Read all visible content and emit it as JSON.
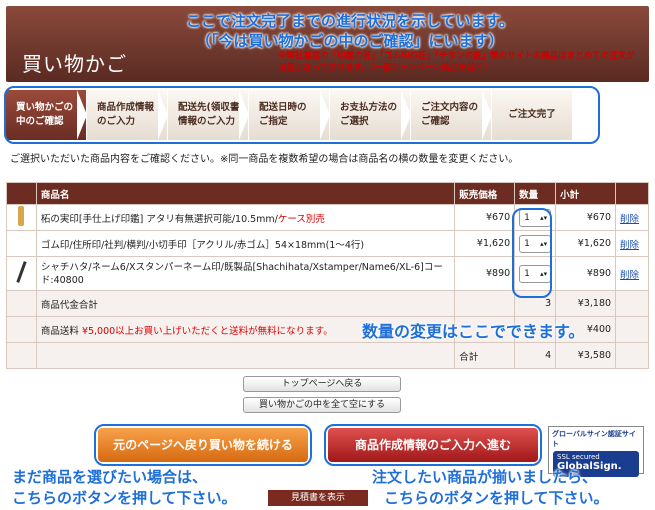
{
  "header": {
    "title": "買い物かご",
    "notice": "※弊社運営の「印鑑の匠」「ゴム印の匠」「チタンの匠」等のサイトの商品はまとめての注文が可能となっております。（一部キャンペーン商品を除く）"
  },
  "steps": [
    {
      "label": "買い物かごの\n中のご確認",
      "active": true
    },
    {
      "label": "商品作成情報\nのご入力",
      "active": false
    },
    {
      "label": "配送先(領収書)\n情報のご入力",
      "active": false
    },
    {
      "label": "配送日時の\nご指定",
      "active": false
    },
    {
      "label": "お支払方法の\nご選択",
      "active": false
    },
    {
      "label": "ご注文内容の\nご確認",
      "active": false
    },
    {
      "label": "ご注文完了",
      "active": false
    }
  ],
  "instruction": "ご選択いただいた商品内容をご確認ください。※同一商品を複数希望の場合は商品名の横の数量を変更ください。",
  "table": {
    "headers": {
      "name": "商品名",
      "price": "販売価格",
      "qty": "数量",
      "subtotal": "小計"
    },
    "items": [
      {
        "name": "柘の実印[手仕上げ印鑑] アタリ有無選択可能/10.5mm/",
        "name_red": "ケース別売",
        "price": "¥670",
        "qty": "1",
        "subtotal": "¥670",
        "delete": "削除"
      },
      {
        "name": "ゴム印/住所印/社判/横判/小切手印［アクリル/赤ゴム］54×18mm(1〜4行)",
        "name_red": "",
        "price": "¥1,620",
        "qty": "1",
        "subtotal": "¥1,620",
        "delete": "削除"
      },
      {
        "name": "シャチハタ/ネーム6/Xスタンパーネーム印/既製品[Shachihata/Xstamper/Name6/XL-6]コード:40800",
        "name_red": "",
        "price": "¥890",
        "qty": "1",
        "subtotal": "¥890",
        "delete": "削除"
      }
    ],
    "product_total_label": "商品代金合計",
    "product_total_qty": "3",
    "product_total": "¥3,180",
    "shipping_label": "商品送料",
    "shipping_note": "¥5,000以上お買い上げいただくと送料が無料になります。",
    "shipping_cost": "¥400",
    "grand_label": "合計",
    "grand_qty": "4",
    "grand_total": "¥3,580"
  },
  "buttons": {
    "top": "トップページへ戻る",
    "clear": "買い物かごの中を全て空にする",
    "continue": "元のページへ戻り買い物を続ける",
    "proceed": "商品作成情報のご入力へ進む",
    "estimate": "見積書を表示"
  },
  "globalsign": {
    "top": "グローバルサイン認証サイト",
    "line1": "SSL secured",
    "brand": "GlobalSign."
  },
  "annotations": {
    "a1": "ここで注文完了までの進行状況を示しています。",
    "a2": "（「今は買い物かごの中のご確認」にいます）",
    "a3": "数量の変更はここでできます。",
    "a4": "まだ商品を選びたい場合は、",
    "a5": "こちらのボタンを押して下さい。",
    "a6": "注文したい商品が揃いましたら、",
    "a7": "こちらのボタンを押して下さい。"
  },
  "colors": {
    "brand": "#6c2c22",
    "annotation": "#1f6fd8",
    "continue": "#e8801e",
    "proceed": "#c82a2a"
  }
}
